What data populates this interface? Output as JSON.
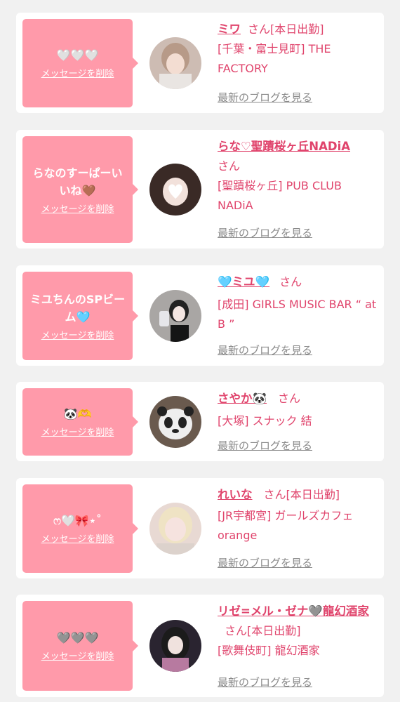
{
  "common": {
    "delete_label": "メッセージを削除",
    "san_label": "さん",
    "blog_label": "最新のブログを見る"
  },
  "entries": [
    {
      "message": "🤍🤍🤍",
      "name": "ミワ",
      "status": "[本日出勤]",
      "shop": "[千葉・富士見町] THE FACTORY"
    },
    {
      "message": "らなのすーぱーいいね🤎",
      "name": "らな♡聖蹟桜ヶ丘NADiA",
      "status": "",
      "shop": "[聖蹟桜ヶ丘] PUB CLUB NADiA"
    },
    {
      "message": "ミユちんのSPビーム🩵",
      "name": "🩵ミユ🩵",
      "status": "",
      "shop": "[成田] GIRLS MUSIC BAR “ at B ”"
    },
    {
      "message": "🐼🫶",
      "name": "さやか🐼",
      "status": "",
      "shop": "[大塚] スナック 結"
    },
    {
      "message": "ෆ🤍🎀⋆˚",
      "name": "れいな",
      "status": "[本日出勤]",
      "shop": "[JR宇都宮] ガールズカフェ orange"
    },
    {
      "message": "🩶🩶🩶",
      "name": "リゼ=メル・ゼナ🩶龍幻酒家",
      "status": "[本日出勤]",
      "shop": "[歌舞伎町] 龍幻酒家"
    }
  ]
}
